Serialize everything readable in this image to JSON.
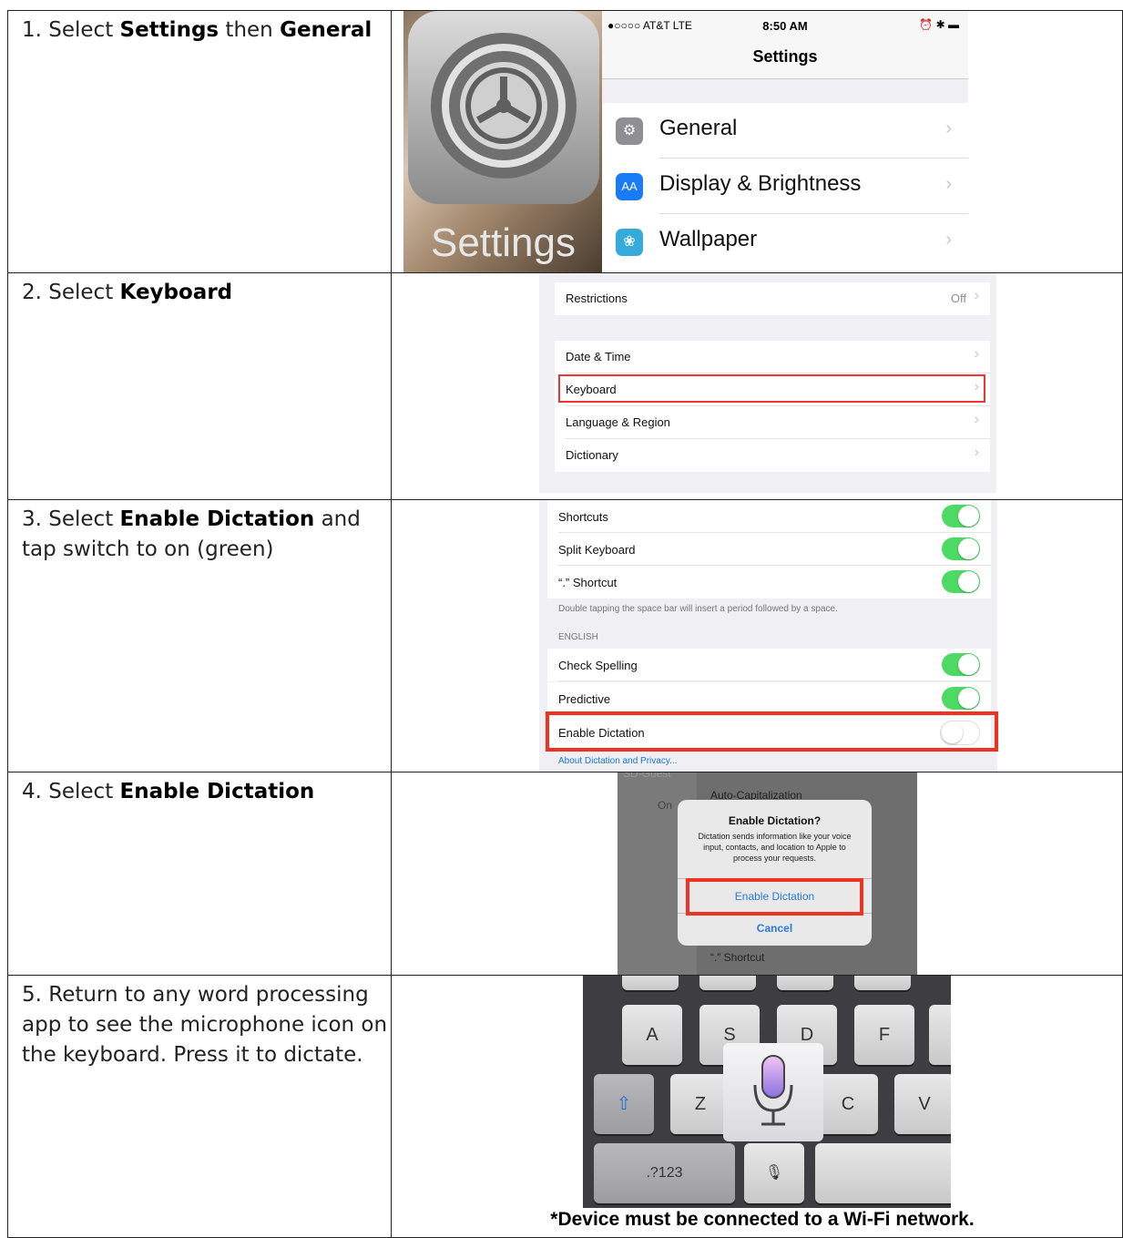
{
  "steps": [
    {
      "pre": "1. Select ",
      "b1": "Settings",
      "mid": " then ",
      "b2": "General"
    },
    {
      "pre": "2. Select ",
      "b1": "Keyboard"
    },
    {
      "pre": "3. Select ",
      "b1": "Enable Dictation",
      "post": " and tap switch to on (green)"
    },
    {
      "pre": "4. Select ",
      "b1": "Enable Dictation"
    },
    {
      "text": "5. Return to any word processing app to see the microphone icon on the keyboard. Press it to dictate."
    }
  ],
  "shot1": {
    "icon_label": "Settings",
    "carrier": "●○○○○ AT&T  LTE",
    "time": "8:50 AM",
    "status_right": "⏰ ✱ ▬",
    "title": "Settings",
    "items": [
      {
        "label": "General",
        "icon": "gear-icon",
        "color": "#8e8e93",
        "glyph": "⚙"
      },
      {
        "label": "Display & Brightness",
        "icon": "display-icon",
        "color": "#1a7cf5",
        "glyph": "AA"
      },
      {
        "label": "Wallpaper",
        "icon": "flower-icon",
        "color": "#37aadc",
        "glyph": "❀"
      }
    ]
  },
  "shot2": {
    "restrictions": "Restrictions",
    "restrictions_value": "Off",
    "items": [
      "Date & Time",
      "Keyboard",
      "Language & Region",
      "Dictionary"
    ]
  },
  "shot3": {
    "top_items": [
      "Shortcuts",
      "Split Keyboard",
      "“.” Shortcut"
    ],
    "note": "Double tapping the space bar will insert a period followed by a space.",
    "section": "ENGLISH",
    "bottom_items": [
      "Check Spelling",
      "Predictive",
      "Enable Dictation"
    ],
    "link": "About Dictation and Privacy..."
  },
  "shot4": {
    "bg_top_left": "SD-Guest",
    "bg_on": "On",
    "bg_top_right": "Auto-Capitalization",
    "dialog_title": "Enable Dictation?",
    "dialog_message": "Dictation sends information like your voice input, contacts, and location to Apple to process your requests.",
    "enable_button": "Enable Dictation",
    "cancel_button": "Cancel",
    "bg_bottom": "“.” Shortcut"
  },
  "shot5": {
    "keys_row1": [
      "A",
      "S",
      "D",
      "F"
    ],
    "keys_row2": [
      "Z",
      "C",
      "V"
    ],
    "numbers_key": ".?123",
    "note": "*Device must be connected to a Wi-Fi network."
  }
}
